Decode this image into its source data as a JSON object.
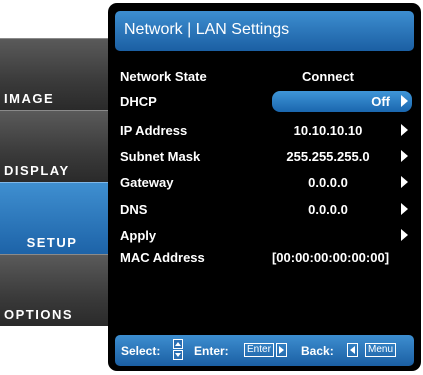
{
  "sidebar": {
    "tabs": [
      {
        "label": "IMAGE",
        "active": false
      },
      {
        "label": "DISPLAY",
        "active": false
      },
      {
        "label": "SETUP",
        "active": true
      },
      {
        "label": "OPTIONS",
        "active": false
      }
    ]
  },
  "header": {
    "title": "Network | LAN Settings"
  },
  "rows": [
    {
      "label": "Network State",
      "value": "Connect",
      "arrow": false,
      "selected": false
    },
    {
      "label": "DHCP",
      "value": "Off",
      "arrow": true,
      "selected": true
    },
    {
      "label": "IP Address",
      "value": "10.10.10.10",
      "arrow": true,
      "selected": false
    },
    {
      "label": "Subnet Mask",
      "value": "255.255.255.0",
      "arrow": true,
      "selected": false
    },
    {
      "label": "Gateway",
      "value": "0.0.0.0",
      "arrow": true,
      "selected": false
    },
    {
      "label": "DNS",
      "value": "0.0.0.0",
      "arrow": true,
      "selected": false
    },
    {
      "label": "Apply",
      "value": "",
      "arrow": true,
      "selected": false
    },
    {
      "label": "MAC Address",
      "value": "[00:00:00:00:00:00]",
      "arrow": false,
      "selected": false
    }
  ],
  "footer": {
    "select_label": "Select:",
    "enter_label": "Enter:",
    "enter_key": "Enter",
    "back_label": "Back:",
    "menu_key": "Menu"
  },
  "colors": {
    "accent": "#1f6fb8",
    "panel": "#000000",
    "tab": "#3a3a3a"
  }
}
